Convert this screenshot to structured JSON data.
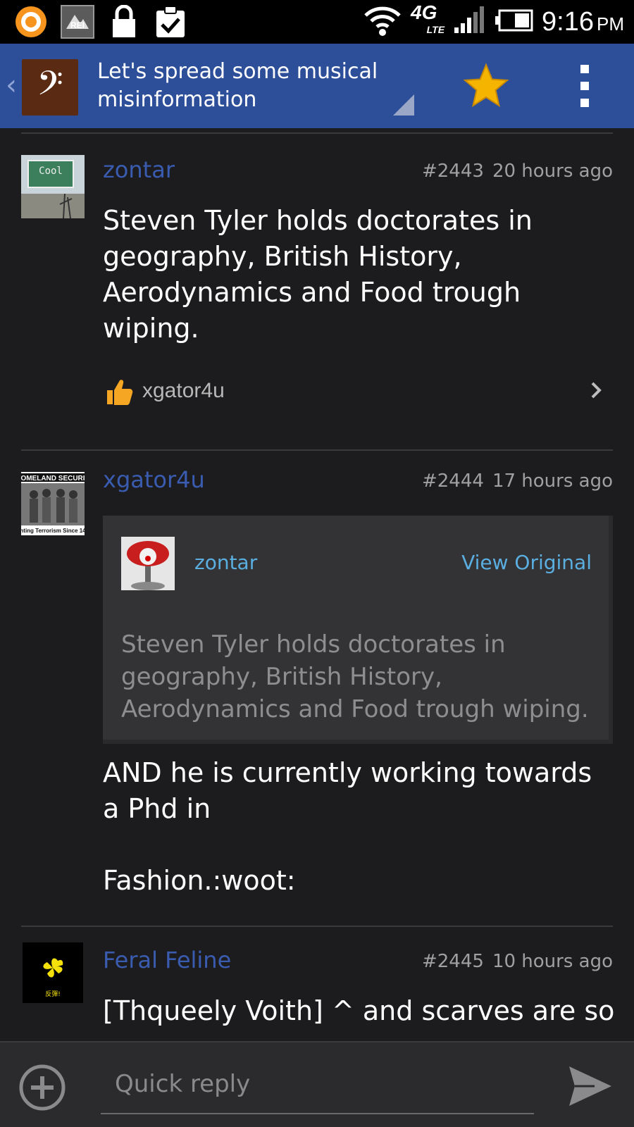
{
  "status_bar": {
    "time": "9:16",
    "ampm": "PM",
    "network_label": "4G",
    "network_sub": "LTE",
    "notification_icons": [
      "circle-app-icon",
      "rei-icon",
      "lock-icon",
      "clipboard-check-icon"
    ]
  },
  "action_bar": {
    "title": "Let's spread some musical misinformation",
    "app_icon_glyph": "𝄢"
  },
  "posts": [
    {
      "author": "zontar",
      "post_number": "#2443",
      "time_ago": "20 hours ago",
      "body": "Steven Tyler holds doctorates in geography, British History, Aerodynamics and Food trough wiping.",
      "avatar_text": "Cool",
      "liked_by": "xgator4u"
    },
    {
      "author": "xgator4u",
      "post_number": "#2444",
      "time_ago": "17 hours ago",
      "avatar_text_top": "OMELAND SECURI",
      "avatar_text_bottom": "hting Terrorism Since 14",
      "quote": {
        "author": "zontar",
        "view_original_label": "View Original",
        "text": "Steven Tyler holds doctorates in geography, British History, Aerodynamics and Food trough wiping."
      },
      "body": "AND he is currently working towards a Phd in\n\nFashion.:woot:"
    },
    {
      "author": "Feral Feline",
      "post_number": "#2445",
      "time_ago": "10 hours ago",
      "avatar_text": "反彈!",
      "body": "[Thqueely Voith] ^ and scarves are so"
    }
  ],
  "reply": {
    "placeholder": "Quick reply"
  },
  "colors": {
    "action_bar": "#2d4f9a",
    "background": "#1c1c1e",
    "author": "#3a5cb0",
    "link": "#5aaee0",
    "star": "#f5b400"
  }
}
